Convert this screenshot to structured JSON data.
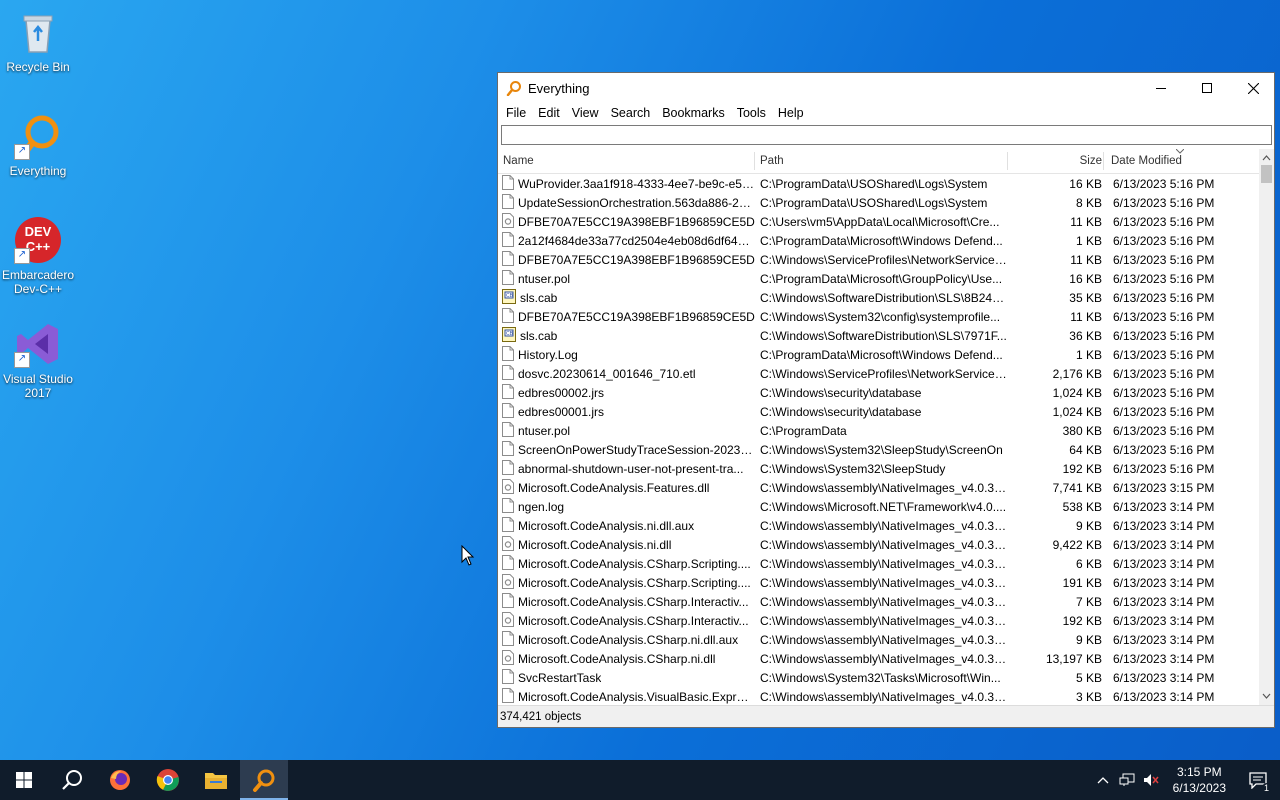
{
  "desktop": {
    "icons": [
      {
        "label": "Recycle Bin"
      },
      {
        "label": "Everything"
      },
      {
        "label": "Embarcadero Dev-C++",
        "logo_text": "DEV C++"
      },
      {
        "label": "Visual Studio 2017"
      }
    ]
  },
  "window": {
    "title": "Everything",
    "menu": [
      "File",
      "Edit",
      "View",
      "Search",
      "Bookmarks",
      "Tools",
      "Help"
    ],
    "search": {
      "value": "",
      "placeholder": ""
    },
    "columns": {
      "name": "Name",
      "path": "Path",
      "size": "Size",
      "date": "Date Modified"
    },
    "rows": [
      {
        "icon": "document-icon",
        "name": "WuProvider.3aa1f918-4333-4ee7-be9c-e5a...",
        "path": "C:\\ProgramData\\USOShared\\Logs\\System",
        "size": "16 KB",
        "date": "6/13/2023 5:16 PM"
      },
      {
        "icon": "document-icon",
        "name": "UpdateSessionOrchestration.563da886-21...",
        "path": "C:\\ProgramData\\USOShared\\Logs\\System",
        "size": "8 KB",
        "date": "6/13/2023 5:16 PM"
      },
      {
        "icon": "system-file-icon",
        "name": "DFBE70A7E5CC19A398EBF1B96859CE5D",
        "path": "C:\\Users\\vm5\\AppData\\Local\\Microsoft\\Cre...",
        "size": "11 KB",
        "date": "6/13/2023 5:16 PM"
      },
      {
        "icon": "document-icon",
        "name": "2a12f4684de33a77cd2504e4eb08d6df649b...",
        "path": "C:\\ProgramData\\Microsoft\\Windows Defend...",
        "size": "1 KB",
        "date": "6/13/2023 5:16 PM"
      },
      {
        "icon": "document-icon",
        "name": "DFBE70A7E5CC19A398EBF1B96859CE5D",
        "path": "C:\\Windows\\ServiceProfiles\\NetworkService\\...",
        "size": "11 KB",
        "date": "6/13/2023 5:16 PM"
      },
      {
        "icon": "document-icon",
        "name": "ntuser.pol",
        "path": "C:\\ProgramData\\Microsoft\\GroupPolicy\\Use...",
        "size": "16 KB",
        "date": "6/13/2023 5:16 PM"
      },
      {
        "icon": "cab-icon",
        "name": "sls.cab",
        "path": "C:\\Windows\\SoftwareDistribution\\SLS\\8B24B...",
        "size": "35 KB",
        "date": "6/13/2023 5:16 PM"
      },
      {
        "icon": "document-icon",
        "name": "DFBE70A7E5CC19A398EBF1B96859CE5D",
        "path": "C:\\Windows\\System32\\config\\systemprofile...",
        "size": "11 KB",
        "date": "6/13/2023 5:16 PM"
      },
      {
        "icon": "cab-icon",
        "name": "sls.cab",
        "path": "C:\\Windows\\SoftwareDistribution\\SLS\\7971F...",
        "size": "36 KB",
        "date": "6/13/2023 5:16 PM"
      },
      {
        "icon": "document-icon",
        "name": "History.Log",
        "path": "C:\\ProgramData\\Microsoft\\Windows Defend...",
        "size": "1 KB",
        "date": "6/13/2023 5:16 PM"
      },
      {
        "icon": "document-icon",
        "name": "dosvc.20230614_001646_710.etl",
        "path": "C:\\Windows\\ServiceProfiles\\NetworkService\\...",
        "size": "2,176 KB",
        "date": "6/13/2023 5:16 PM"
      },
      {
        "icon": "document-icon",
        "name": "edbres00002.jrs",
        "path": "C:\\Windows\\security\\database",
        "size": "1,024 KB",
        "date": "6/13/2023 5:16 PM"
      },
      {
        "icon": "document-icon",
        "name": "edbres00001.jrs",
        "path": "C:\\Windows\\security\\database",
        "size": "1,024 KB",
        "date": "6/13/2023 5:16 PM"
      },
      {
        "icon": "document-icon",
        "name": "ntuser.pol",
        "path": "C:\\ProgramData",
        "size": "380 KB",
        "date": "6/13/2023 5:16 PM"
      },
      {
        "icon": "document-icon",
        "name": "ScreenOnPowerStudyTraceSession-2023-0...",
        "path": "C:\\Windows\\System32\\SleepStudy\\ScreenOn",
        "size": "64 KB",
        "date": "6/13/2023 5:16 PM"
      },
      {
        "icon": "document-icon",
        "name": "abnormal-shutdown-user-not-present-tra...",
        "path": "C:\\Windows\\System32\\SleepStudy",
        "size": "192 KB",
        "date": "6/13/2023 5:16 PM"
      },
      {
        "icon": "system-file-icon",
        "name": "Microsoft.CodeAnalysis.Features.dll",
        "path": "C:\\Windows\\assembly\\NativeImages_v4.0.30...",
        "size": "7,741 KB",
        "date": "6/13/2023 3:15 PM"
      },
      {
        "icon": "document-icon",
        "name": "ngen.log",
        "path": "C:\\Windows\\Microsoft.NET\\Framework\\v4.0....",
        "size": "538 KB",
        "date": "6/13/2023 3:14 PM"
      },
      {
        "icon": "document-icon",
        "name": "Microsoft.CodeAnalysis.ni.dll.aux",
        "path": "C:\\Windows\\assembly\\NativeImages_v4.0.30...",
        "size": "9 KB",
        "date": "6/13/2023 3:14 PM"
      },
      {
        "icon": "system-file-icon",
        "name": "Microsoft.CodeAnalysis.ni.dll",
        "path": "C:\\Windows\\assembly\\NativeImages_v4.0.30...",
        "size": "9,422 KB",
        "date": "6/13/2023 3:14 PM"
      },
      {
        "icon": "document-icon",
        "name": "Microsoft.CodeAnalysis.CSharp.Scripting....",
        "path": "C:\\Windows\\assembly\\NativeImages_v4.0.30...",
        "size": "6 KB",
        "date": "6/13/2023 3:14 PM"
      },
      {
        "icon": "system-file-icon",
        "name": "Microsoft.CodeAnalysis.CSharp.Scripting....",
        "path": "C:\\Windows\\assembly\\NativeImages_v4.0.30...",
        "size": "191 KB",
        "date": "6/13/2023 3:14 PM"
      },
      {
        "icon": "document-icon",
        "name": "Microsoft.CodeAnalysis.CSharp.Interactiv...",
        "path": "C:\\Windows\\assembly\\NativeImages_v4.0.30...",
        "size": "7 KB",
        "date": "6/13/2023 3:14 PM"
      },
      {
        "icon": "system-file-icon",
        "name": "Microsoft.CodeAnalysis.CSharp.Interactiv...",
        "path": "C:\\Windows\\assembly\\NativeImages_v4.0.30...",
        "size": "192 KB",
        "date": "6/13/2023 3:14 PM"
      },
      {
        "icon": "document-icon",
        "name": "Microsoft.CodeAnalysis.CSharp.ni.dll.aux",
        "path": "C:\\Windows\\assembly\\NativeImages_v4.0.30...",
        "size": "9 KB",
        "date": "6/13/2023 3:14 PM"
      },
      {
        "icon": "system-file-icon",
        "name": "Microsoft.CodeAnalysis.CSharp.ni.dll",
        "path": "C:\\Windows\\assembly\\NativeImages_v4.0.30...",
        "size": "13,197 KB",
        "date": "6/13/2023 3:14 PM"
      },
      {
        "icon": "document-icon",
        "name": "SvcRestartTask",
        "path": "C:\\Windows\\System32\\Tasks\\Microsoft\\Win...",
        "size": "5 KB",
        "date": "6/13/2023 3:14 PM"
      },
      {
        "icon": "document-icon",
        "name": "Microsoft.CodeAnalysis.VisualBasic.Expres...",
        "path": "C:\\Windows\\assembly\\NativeImages_v4.0.30...",
        "size": "3 KB",
        "date": "6/13/2023 3:14 PM"
      }
    ],
    "status": "374,421 objects"
  },
  "taskbar": {
    "pinned": [
      "start-icon",
      "search-icon",
      "firefox-icon",
      "chrome-icon",
      "file-explorer-icon",
      "everything-icon"
    ],
    "active": "everything-icon",
    "clock": {
      "time": "3:15 PM",
      "date": "6/13/2023"
    },
    "notification_count": "1"
  },
  "colors": {
    "desktop": "#1a86e6",
    "taskbar": "#101c2b",
    "everything_orange": "#e8860c"
  }
}
